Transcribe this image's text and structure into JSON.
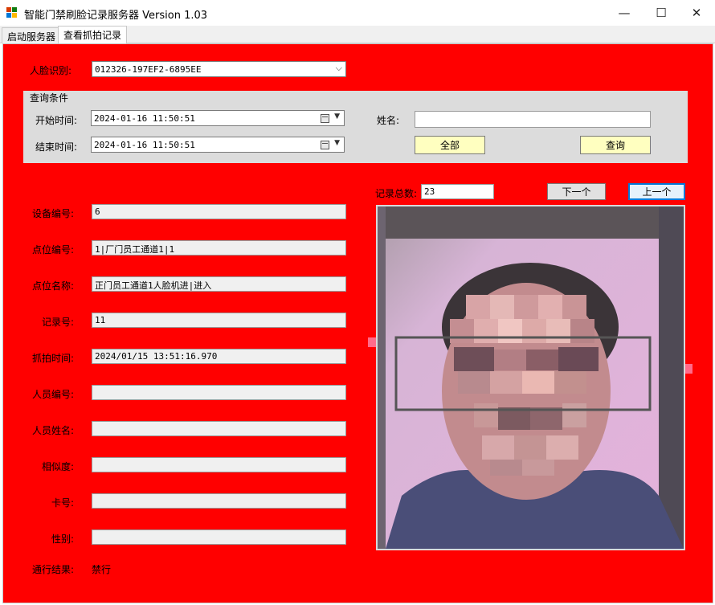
{
  "window": {
    "title": "智能门禁刷脸记录服务器 Version 1.03",
    "minimize_glyph": "—",
    "maximize_glyph": "☐",
    "close_glyph": "✕"
  },
  "tabs": [
    {
      "label": "启动服务器",
      "active": false
    },
    {
      "label": "查看抓拍记录",
      "active": true
    }
  ],
  "face_recognition": {
    "label": "人脸识别:",
    "selected": "012326-197EF2-6895EE"
  },
  "query": {
    "group_title": "查询条件",
    "start_time_label": "开始时间:",
    "start_time": "2024-01-16 11:50:51",
    "end_time_label": "结束时间:",
    "end_time": "2024-01-16 11:50:51",
    "name_label": "姓名:",
    "name_value": "",
    "all_button": "全部",
    "query_button": "查询"
  },
  "records": {
    "total_label": "记录总数:",
    "total": "23",
    "next_button": "下一个",
    "prev_button": "上一个"
  },
  "details": [
    {
      "label": "设备编号:",
      "value": "6"
    },
    {
      "label": "点位编号:",
      "value": "1|厂门员工通道1|1"
    },
    {
      "label": "点位名称:",
      "value": "正门员工通道1人脸机进|进入"
    },
    {
      "label": "记录号:",
      "value": "11"
    },
    {
      "label": "抓拍时间:",
      "value": "2024/01/15 13:51:16.970"
    },
    {
      "label": "人员编号:",
      "value": ""
    },
    {
      "label": "人员姓名:",
      "value": ""
    },
    {
      "label": "相似度:",
      "value": ""
    },
    {
      "label": "卡号:",
      "value": ""
    },
    {
      "label": "性别:",
      "value": ""
    }
  ],
  "result": {
    "label": "通行结果:",
    "value": "禁行"
  },
  "colors": {
    "panel_background": "#ff0000",
    "button_yellow": "#ffffc0",
    "focus_blue": "#0078d7"
  },
  "icons": {
    "app": "app-icon",
    "combo": "chevron-down-icon",
    "date_picker": "calendar-icon"
  }
}
